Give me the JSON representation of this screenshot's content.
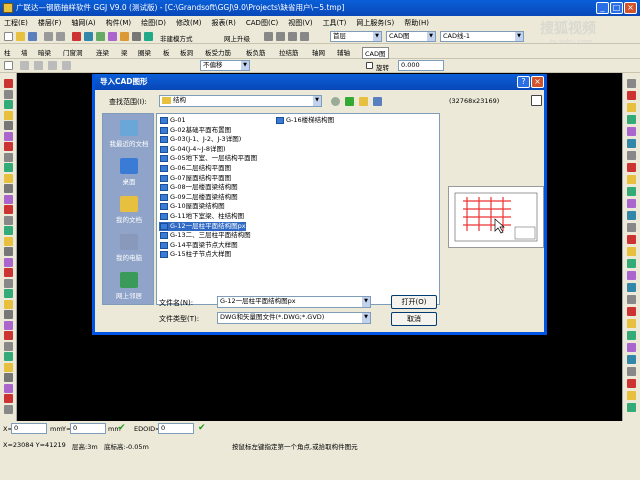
{
  "app": {
    "title": "广联达—钢筋抽样软件 GGJ V9.0 (测试版) - [C:\\Grandsoft\\GGJ\\9.0\\Projects\\缺省用户\\~5.tmp]",
    "min_glyph": "_",
    "max_glyph": "□",
    "close_glyph": "×"
  },
  "menu": [
    "工程(E)",
    "楼层(F)",
    "轴网(A)",
    "构件(M)",
    "绘图(D)",
    "修改(M)",
    "报表(R)",
    "CAD图(C)",
    "视图(V)",
    "工具(T)",
    "网上服务(S)",
    "帮助(H)"
  ],
  "toolbar1": {
    "new_axis": "非建模方式",
    "online": "网上升级",
    "floor_combo": "首层",
    "cad_combo": "CAD图",
    "cad_item_combo": "CAD线-1"
  },
  "toolbar2": [
    "柱",
    "墙",
    "暗梁",
    "门窗洞",
    "连梁",
    "梁",
    "圈梁",
    "板",
    "板洞",
    "板受力筋",
    "板负筋",
    "拉结筋",
    "轴网",
    "辅轴",
    "CAD图"
  ],
  "toolbar3": {
    "offset_combo": "不偏移",
    "rotate_label": "旋转",
    "rotate_value": "0.000"
  },
  "watermark": {
    "line1": "搜狐视频",
    "line2": "tv.sohu.com"
  },
  "dialog": {
    "title": "导入CAD图形",
    "help_glyph": "?",
    "close_glyph": "×",
    "look_in_label": "查找范围(I):",
    "look_in_value": "结构",
    "dims": "(32768x23169)",
    "places": [
      {
        "label": "我最近的文档",
        "icon": "recent-docs-icon"
      },
      {
        "label": "桌面",
        "icon": "desktop-icon"
      },
      {
        "label": "我的文档",
        "icon": "my-documents-icon"
      },
      {
        "label": "我的电脑",
        "icon": "my-computer-icon"
      },
      {
        "label": "网上邻居",
        "icon": "network-places-icon"
      }
    ],
    "files": [
      "G-01",
      "G-02基础平面布置图",
      "G-03(J-1、J-2、J-3详图)",
      "G-04(J-4~J-8详图)",
      "G-05地下室、一层结构平面图",
      "G-06二层结构平面图",
      "G-07屋面结构平面图",
      "G-08一层楼面梁结构图",
      "G-09二层楼面梁结构图",
      "G-10屋面梁结构图",
      "G-11地下室梁、柱结构图",
      "G-12一层柱平面结构图px",
      "G-13二、三层柱平面结构图",
      "G-14平面梁节点大样图",
      "G-15柱子节点大样图"
    ],
    "files_col2": [
      "G-16楼梯结构图"
    ],
    "selected_index": 11,
    "filename_label": "文件名(N):",
    "filename_value": "G-12一层柱平面结构图px",
    "filetype_label": "文件类型(T):",
    "filetype_value": "DWG和矢量图文件(*.DWG;*.GVD)",
    "open_button": "打开(O)",
    "cancel_button": "取消"
  },
  "coord_bar": {
    "x_label": "X=",
    "x_value": "0",
    "x_unit": "mm",
    "y_label": "Y=",
    "y_value": "0",
    "y_unit": "mm",
    "edoid_label": "EDOID=",
    "edoid_value": "0"
  },
  "status": {
    "coords": "X=23084 Y=41219",
    "floor_height": "层高:3m",
    "base_height": "底标高:-0.05m",
    "hint": "按鼠标左键指定第一个角点,或拾取构件图元"
  }
}
